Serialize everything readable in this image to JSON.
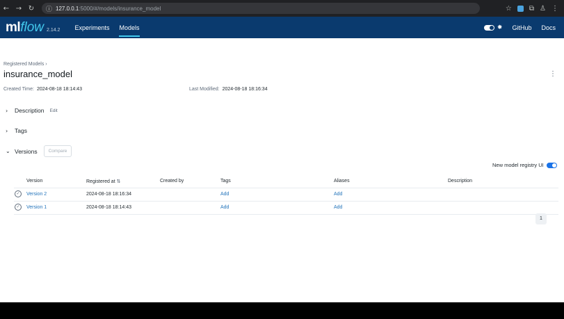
{
  "browser": {
    "url_host": "127.0.0.1",
    "url_path": ":5000/#/models/insurance_model"
  },
  "header": {
    "logo_ml": "ml",
    "logo_flow": "flow",
    "version": "2.14.2",
    "nav": [
      {
        "label": "Experiments"
      },
      {
        "label": "Models"
      }
    ],
    "github": "GitHub",
    "docs": "Docs"
  },
  "page": {
    "breadcrumb": "Registered Models ›",
    "title": "insurance_model",
    "created_label": "Created Time:",
    "created_value": "2024-08-18 18:14:43",
    "modified_label": "Last Modified:",
    "modified_value": "2024-08-18 18:16:34"
  },
  "sections": {
    "description": "Description",
    "edit": "Edit",
    "tags": "Tags",
    "versions": "Versions",
    "compare": "Compare"
  },
  "registry_toggle": {
    "label": "New model registry UI",
    "enabled": true
  },
  "versions_table": {
    "headers": [
      "Version",
      "Registered at",
      "Created by",
      "Tags",
      "Aliases",
      "Description"
    ],
    "rows": [
      {
        "version": "Version 2",
        "registered_at": "2024-08-18 18:16:34",
        "created_by": "",
        "tags": "Add",
        "aliases": "Add",
        "description": ""
      },
      {
        "version": "Version 1",
        "registered_at": "2024-08-18 18:14:43",
        "created_by": "",
        "tags": "Add",
        "aliases": "Add",
        "description": ""
      }
    ]
  },
  "pagination": {
    "current_page": "1"
  },
  "colors": {
    "header_bg": "#0a3a6e",
    "accent": "#43c9ed",
    "link": "#2374bb",
    "toggle_on": "#1a73e8"
  }
}
